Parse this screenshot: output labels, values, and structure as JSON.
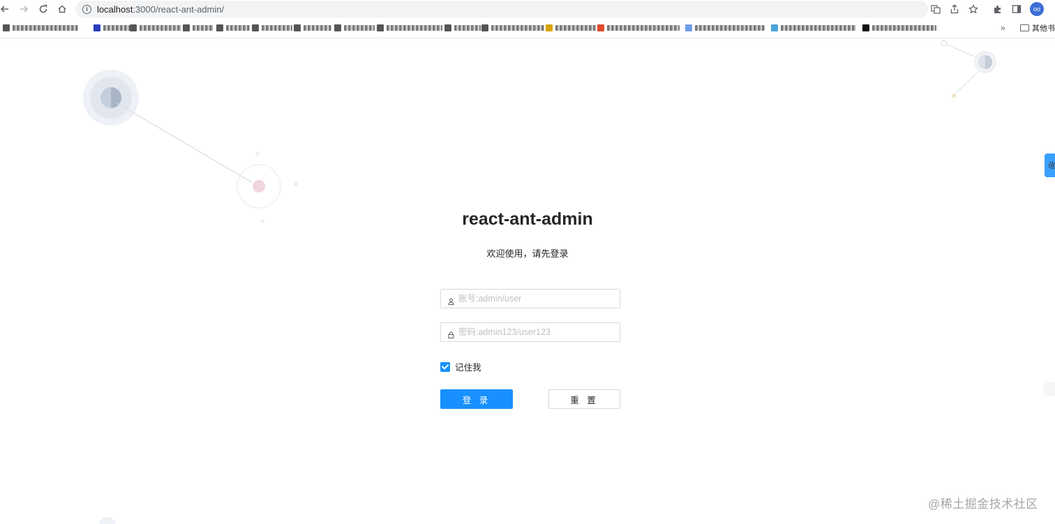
{
  "browser": {
    "url_host": "localhost",
    "url_rest": ":3000/react-ant-admin/",
    "back_icon": "arrow-left-icon",
    "forward_icon": "arrow-right-icon",
    "reload_icon": "reload-icon",
    "home_icon": "home-icon",
    "more_bookmarks": "»",
    "other_bookmarks": "其他书"
  },
  "login": {
    "title": "react-ant-admin",
    "subtitle": "欢迎使用，请先登录",
    "username_placeholder": "账号:admin/user",
    "password_placeholder": "密码:admin123/user123",
    "remember_label": "记住我",
    "remember_checked": true,
    "login_button": "登 录",
    "reset_button": "重 置"
  },
  "colors": {
    "primary": "#1890ff",
    "border": "#d9d9d9"
  },
  "watermark": "@稀土掘金技术社区"
}
